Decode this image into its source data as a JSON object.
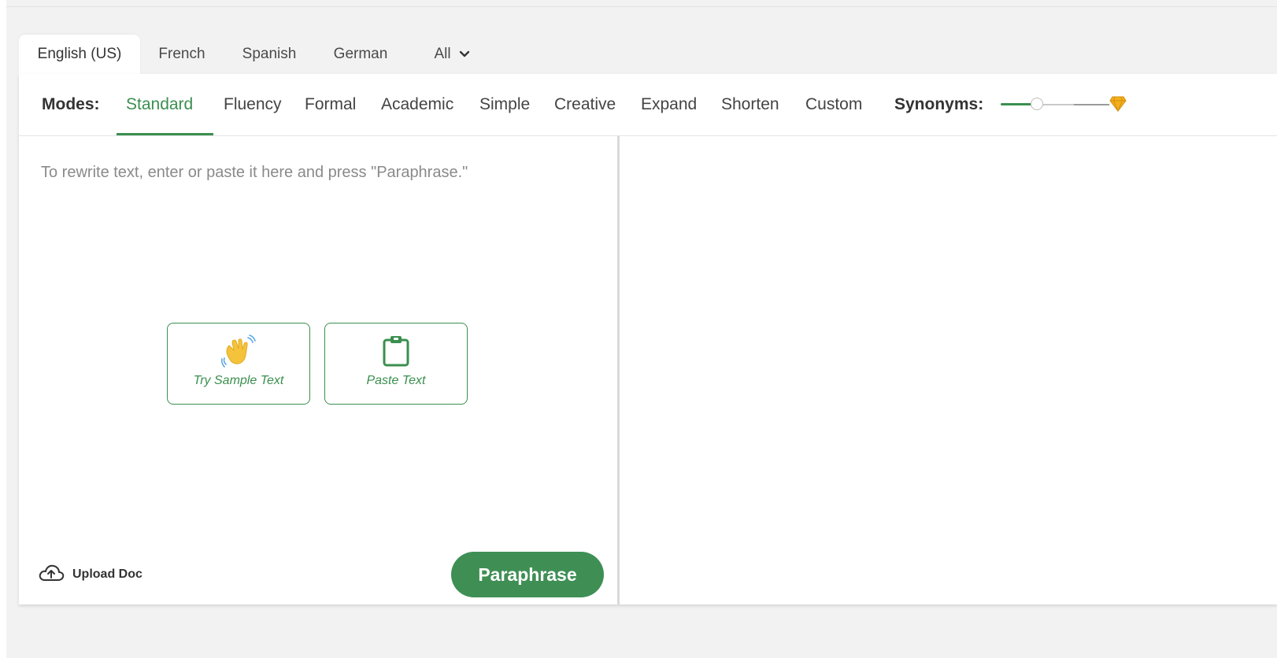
{
  "language_tabs": [
    {
      "label": "English (US)",
      "active": true
    },
    {
      "label": "French",
      "active": false
    },
    {
      "label": "Spanish",
      "active": false
    },
    {
      "label": "German",
      "active": false
    },
    {
      "label": "All",
      "active": false
    }
  ],
  "modes": {
    "label": "Modes:",
    "items": [
      {
        "label": "Standard",
        "active": true
      },
      {
        "label": "Fluency",
        "active": false
      },
      {
        "label": "Formal",
        "active": false
      },
      {
        "label": "Academic",
        "active": false
      },
      {
        "label": "Simple",
        "active": false
      },
      {
        "label": "Creative",
        "active": false
      },
      {
        "label": "Expand",
        "active": false
      },
      {
        "label": "Shorten",
        "active": false
      },
      {
        "label": "Custom",
        "active": false
      }
    ]
  },
  "synonyms": {
    "label": "Synonyms:",
    "level_fraction": 0.3,
    "premium_icon": "diamond-icon"
  },
  "editor": {
    "placeholder": "To rewrite text, enter or paste it here and press \"Paraphrase.\"",
    "sample_button": {
      "label": "Try Sample Text",
      "icon": "waving-hand-icon"
    },
    "paste_button": {
      "label": "Paste Text",
      "icon": "clipboard-icon"
    },
    "upload": {
      "label": "Upload Doc",
      "icon": "cloud-upload-icon"
    },
    "paraphrase_button": "Paraphrase"
  },
  "colors": {
    "accent": "#3a8f4f",
    "button": "#3f8f55",
    "background": "#f2f2f2"
  }
}
